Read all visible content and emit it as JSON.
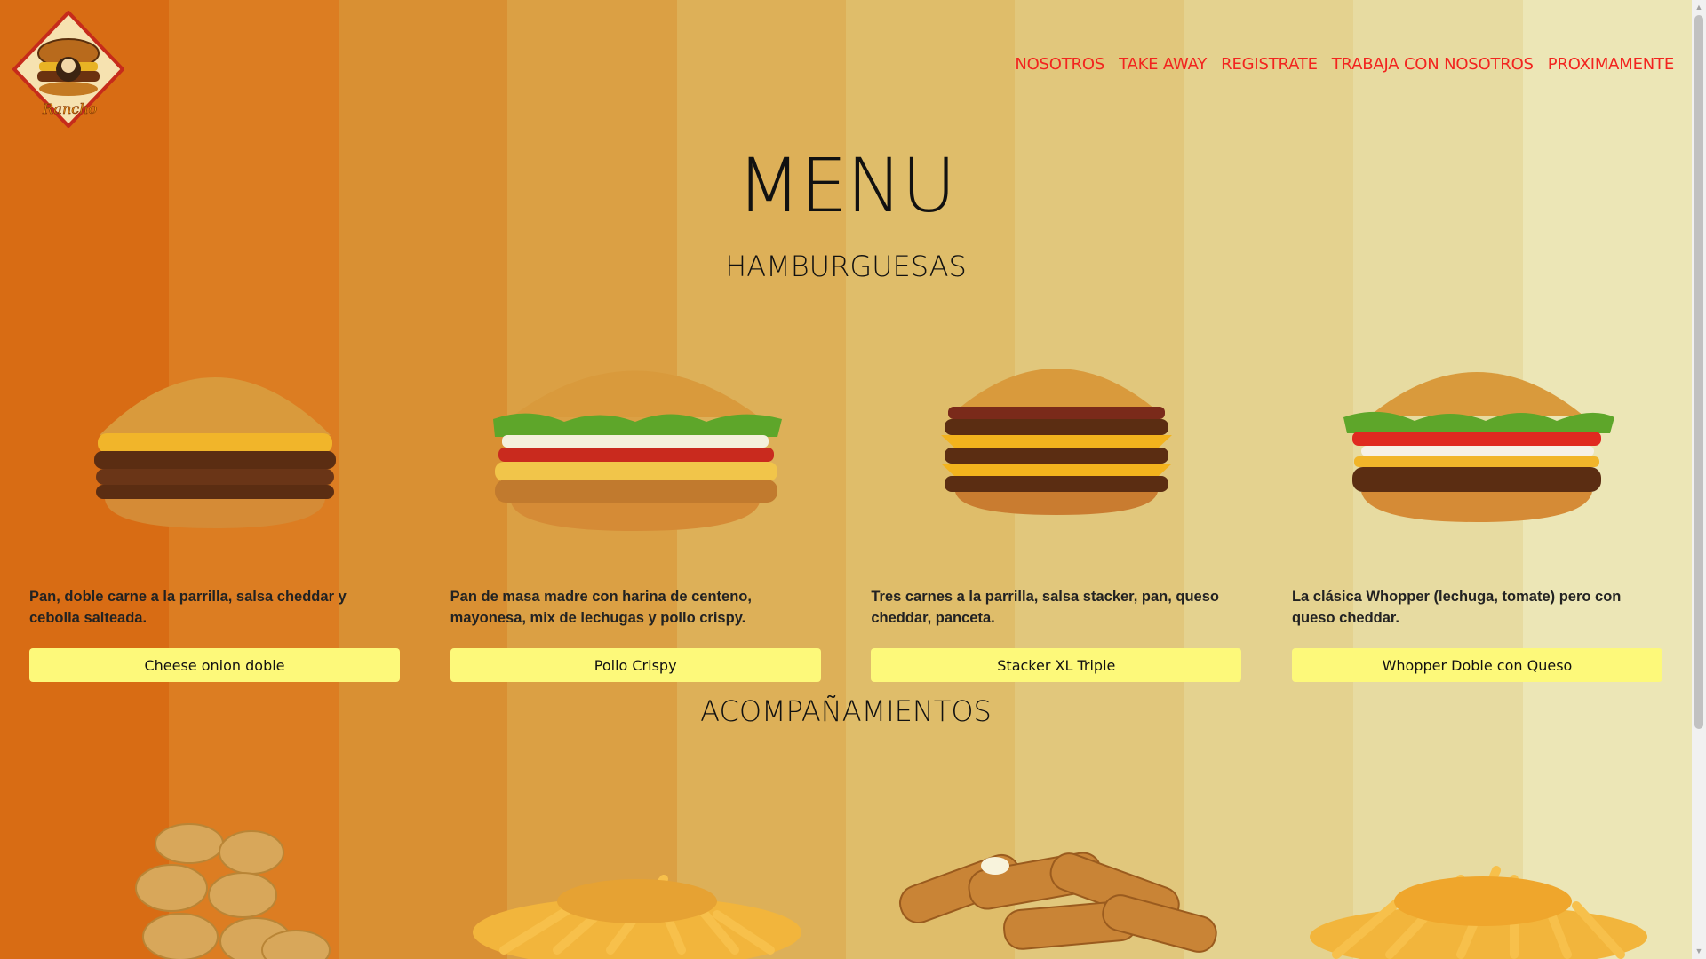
{
  "background_colors": [
    "#d86c14",
    "#dc7d22",
    "#d99033",
    "#dba044",
    "#ddb058",
    "#dfbd6a",
    "#e1c77c",
    "#e4d28f",
    "#e7dba1",
    "#ece6b6"
  ],
  "header": {
    "logo_name": "logo-emblem",
    "logo_text": "Rancho Burger",
    "nav": [
      "NOSOTROS",
      "TAKE AWAY",
      "REGISTRATE",
      "TRABAJA CON NOSOTROS",
      "PROXIMAMENTE"
    ]
  },
  "menu": {
    "title": "MENU",
    "section_burgers": "HAMBURGUESAS",
    "section_sides": "ACOMPAÑAMIENTOS"
  },
  "burgers": [
    {
      "description": "Pan, doble carne a la parrilla, salsa cheddar y cebolla salteada.",
      "button": "Cheese onion doble"
    },
    {
      "description": "Pan de masa madre con harina de centeno, mayonesa, mix de lechugas y pollo crispy.",
      "button": "Pollo Crispy"
    },
    {
      "description": "Tres carnes a la parrilla, salsa stacker, pan, queso cheddar, panceta.",
      "button": "Stacker XL Triple"
    },
    {
      "description": "La clásica Whopper (lechuga, tomate) pero con queso cheddar.",
      "button": "Whopper Doble con Queso"
    }
  ],
  "accent": "#f2241f",
  "button_color": "#fdf97a"
}
